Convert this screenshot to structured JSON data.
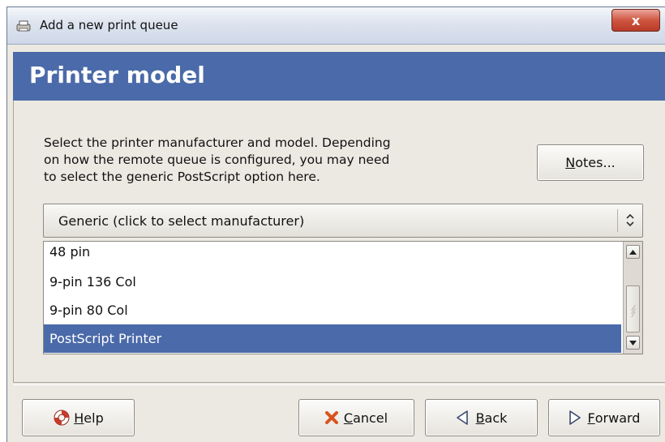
{
  "window": {
    "title": "Add a new print queue",
    "close_label": "x"
  },
  "banner": {
    "title": "Printer model"
  },
  "description": {
    "lines": [
      "Select the printer manufacturer and model. Depending",
      "on how the remote queue is configured, you may need",
      "to select the generic PostScript option here."
    ]
  },
  "notes_button": {
    "mnemonic": "N",
    "rest": "otes..."
  },
  "manufacturer_combo": {
    "value": "Generic (click to select manufacturer)"
  },
  "model_list": {
    "items": [
      {
        "label": "48 pin",
        "selected": false
      },
      {
        "label": "9-pin 136 Col",
        "selected": false
      },
      {
        "label": "9-pin 80 Col",
        "selected": false
      },
      {
        "label": "PostScript Printer",
        "selected": true
      }
    ]
  },
  "buttons": {
    "help": {
      "mnemonic": "H",
      "rest": "elp",
      "icon": "lifebuoy-icon"
    },
    "cancel": {
      "mnemonic": "C",
      "rest": "ancel",
      "icon": "cross-icon"
    },
    "back": {
      "mnemonic": "B",
      "rest": "ack",
      "icon": "left-arrow-icon"
    },
    "forward": {
      "mnemonic": "F",
      "rest": "orward",
      "icon": "right-arrow-icon"
    }
  },
  "colors": {
    "banner": "#4b6aa9",
    "selection": "#4b6aa9",
    "cancel_icon": "#d9531e",
    "help_icon": "#cc3a2a"
  }
}
